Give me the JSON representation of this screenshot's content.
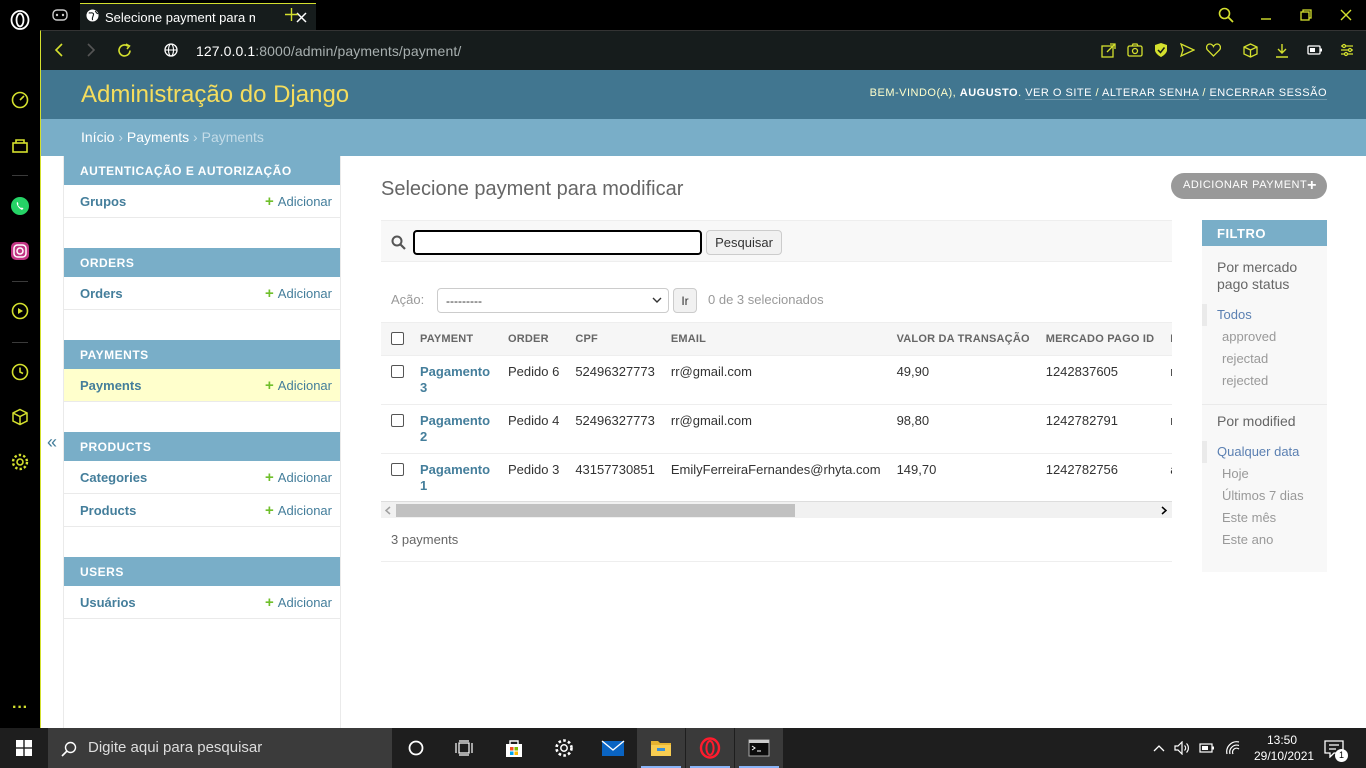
{
  "browser": {
    "tab_title": "Selecione payment para mo",
    "url_host": "127.0.0.1",
    "url_rest": ":8000/admin/payments/payment/"
  },
  "header": {
    "site_name": "Administração do Django",
    "welcome": "BEM-VINDO(A), ",
    "user": "AUGUSTO",
    "view_site": "VER O SITE",
    "change_password": "ALTERAR SENHA",
    "logout": "ENCERRAR SESSÃO"
  },
  "breadcrumbs": {
    "home": "Início",
    "app": "Payments",
    "model": "Payments"
  },
  "nav": {
    "toggle": "«",
    "add_label": "Adicionar",
    "modules": [
      {
        "caption": "AUTENTICAÇÃO E AUTORIZAÇÃO",
        "items": [
          "Grupos"
        ]
      },
      {
        "caption": "ORDERS",
        "items": [
          "Orders"
        ]
      },
      {
        "caption": "PAYMENTS",
        "items": [
          "Payments"
        ]
      },
      {
        "caption": "PRODUCTS",
        "items": [
          "Categories",
          "Products"
        ]
      },
      {
        "caption": "USERS",
        "items": [
          "Usuários"
        ]
      }
    ]
  },
  "content": {
    "title": "Selecione payment para modificar",
    "add_button": "ADICIONAR PAYMENT",
    "search_button": "Pesquisar",
    "search_value": "",
    "action_label": "Ação:",
    "action_selected": "---------",
    "go_button": "Ir",
    "selection_counter": "0 de 3 selecionados",
    "columns": [
      "PAYMENT",
      "ORDER",
      "CPF",
      "EMAIL",
      "VALOR DA TRANSAÇÃO",
      "MERCADO PAGO ID",
      "MERCADO PAGO STATUS"
    ],
    "rows": [
      {
        "payment": "Pagamento 3",
        "order": "Pedido 6",
        "cpf": "52496327773",
        "email": "rr@gmail.com",
        "valor": "49,90",
        "mp_id": "1242837605",
        "status": "rejected"
      },
      {
        "payment": "Pagamento 2",
        "order": "Pedido 4",
        "cpf": "52496327773",
        "email": "rr@gmail.com",
        "valor": "98,80",
        "mp_id": "1242782791",
        "status": "rejected"
      },
      {
        "payment": "Pagamento 1",
        "order": "Pedido 3",
        "cpf": "43157730851",
        "email": "EmilyFerreiraFernandes@rhyta.com",
        "valor": "149,70",
        "mp_id": "1242782756",
        "status": "approved"
      }
    ],
    "paginator": "3 payments"
  },
  "filter": {
    "title": "FILTRO",
    "groups": [
      {
        "title": "Por mercado pago status",
        "options": [
          "Todos",
          "approved",
          "rejectad",
          "rejected"
        ],
        "selected": 0
      },
      {
        "title": "Por modified",
        "options": [
          "Qualquer data",
          "Hoje",
          "Últimos 7 dias",
          "Este mês",
          "Este ano"
        ],
        "selected": 0
      }
    ]
  },
  "taskbar": {
    "search_placeholder": "Digite aqui para pesquisar",
    "time": "13:50",
    "date": "29/10/2021",
    "notifications": "1"
  },
  "colors": {
    "django_header": "#417690",
    "django_breadcrumb": "#79aec8",
    "site_name": "#f5dd5d",
    "opera_accent": "#d4e02e",
    "link": "#447e9b"
  }
}
